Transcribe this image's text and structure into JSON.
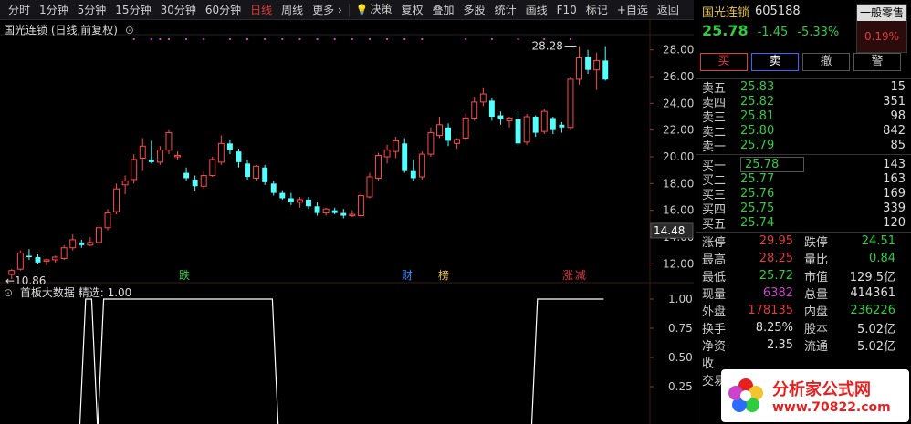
{
  "toolbar": {
    "items": [
      "分时",
      "1分钟",
      "5分钟",
      "15分钟",
      "30分钟",
      "60分钟",
      "日线",
      "周线",
      "更多 ›"
    ],
    "active_index": 6,
    "tools": [
      "决策",
      "复权",
      "叠加",
      "多股",
      "统计",
      "画线",
      "F10",
      "标记",
      "+自选",
      "返回"
    ]
  },
  "chart": {
    "title": "国光连锁 (日线,前复权)",
    "high_marker": "28.28",
    "low_marker": "10.86",
    "cursor_price": "14.48",
    "markers": [
      {
        "text": "跌",
        "color": "#2ecc40"
      },
      {
        "text": "财",
        "color": "#3b8bff"
      },
      {
        "text": "榜",
        "color": "#e8c341"
      },
      {
        "text": "涨",
        "color": "#e23b3b"
      },
      {
        "text": "减",
        "color": "#e23b3b"
      }
    ]
  },
  "indicator": {
    "title": "首板大数据 精选: 1.00",
    "ticks": [
      "1.00",
      "0.75",
      "0.50",
      "0.25"
    ]
  },
  "chart_data": {
    "type": "candlestick",
    "ylim": [
      11.0,
      29.0
    ],
    "yticks": [
      12.0,
      14.0,
      16.0,
      18.0,
      20.0,
      22.0,
      24.0,
      26.0,
      28.0
    ],
    "candles": [
      [
        11.2,
        11.6,
        10.86,
        11.5
      ],
      [
        11.6,
        13.0,
        11.5,
        12.8
      ],
      [
        12.6,
        13.1,
        12.3,
        12.5
      ],
      [
        12.5,
        12.7,
        12.0,
        12.1
      ],
      [
        12.2,
        12.4,
        11.9,
        12.3
      ],
      [
        12.3,
        12.6,
        12.1,
        12.5
      ],
      [
        12.4,
        13.4,
        12.3,
        13.2
      ],
      [
        13.2,
        14.2,
        13.0,
        13.8
      ],
      [
        13.6,
        13.8,
        13.2,
        13.4
      ],
      [
        13.4,
        14.0,
        13.3,
        13.6
      ],
      [
        13.6,
        14.9,
        13.5,
        14.7
      ],
      [
        14.7,
        16.1,
        14.5,
        15.8
      ],
      [
        15.9,
        18.0,
        15.7,
        17.6
      ],
      [
        17.9,
        18.6,
        17.2,
        18.2
      ],
      [
        18.3,
        20.2,
        18.0,
        19.8
      ],
      [
        19.9,
        21.4,
        19.0,
        20.8
      ],
      [
        19.8,
        21.2,
        19.5,
        19.6
      ],
      [
        19.6,
        20.8,
        19.4,
        20.5
      ],
      [
        20.5,
        22.0,
        20.2,
        21.8
      ],
      [
        20.0,
        20.4,
        19.8,
        20.1
      ],
      [
        18.8,
        19.2,
        18.2,
        18.4
      ],
      [
        18.3,
        18.6,
        17.4,
        17.8
      ],
      [
        17.8,
        18.9,
        17.6,
        18.6
      ],
      [
        18.6,
        20.0,
        18.5,
        19.8
      ],
      [
        19.6,
        21.6,
        19.4,
        21.0
      ],
      [
        21.0,
        21.3,
        20.2,
        20.5
      ],
      [
        20.4,
        20.6,
        19.2,
        19.6
      ],
      [
        19.5,
        19.8,
        18.3,
        18.5
      ],
      [
        18.4,
        19.4,
        18.2,
        19.3
      ],
      [
        19.2,
        19.4,
        17.9,
        18.1
      ],
      [
        18.0,
        18.2,
        17.1,
        17.3
      ],
      [
        17.3,
        17.5,
        16.8,
        16.9
      ],
      [
        16.9,
        17.3,
        16.4,
        16.6
      ],
      [
        16.6,
        17.0,
        16.2,
        16.8
      ],
      [
        16.8,
        17.0,
        16.1,
        16.3
      ],
      [
        16.3,
        16.6,
        15.6,
        15.8
      ],
      [
        15.8,
        16.2,
        15.6,
        16.1
      ],
      [
        16.0,
        16.2,
        15.7,
        15.8
      ],
      [
        15.8,
        16.1,
        15.4,
        15.6
      ],
      [
        15.6,
        16.0,
        15.5,
        15.7
      ],
      [
        15.6,
        17.3,
        15.5,
        17.1
      ],
      [
        17.0,
        18.8,
        16.9,
        18.5
      ],
      [
        18.4,
        20.3,
        18.2,
        20.1
      ],
      [
        20.0,
        20.9,
        19.5,
        20.5
      ],
      [
        20.4,
        21.5,
        19.9,
        21.2
      ],
      [
        21.0,
        21.4,
        18.8,
        19.0
      ],
      [
        19.0,
        19.8,
        18.2,
        18.4
      ],
      [
        18.5,
        20.4,
        18.3,
        20.2
      ],
      [
        20.2,
        22.2,
        20.0,
        21.8
      ],
      [
        21.6,
        23.0,
        21.4,
        22.4
      ],
      [
        22.2,
        22.5,
        20.8,
        21.2
      ],
      [
        21.0,
        21.4,
        20.6,
        21.3
      ],
      [
        21.4,
        23.2,
        21.2,
        22.9
      ],
      [
        22.9,
        24.5,
        22.7,
        24.1
      ],
      [
        24.1,
        25.2,
        23.8,
        24.7
      ],
      [
        24.2,
        24.4,
        22.7,
        23.0
      ],
      [
        23.1,
        23.4,
        22.4,
        22.8
      ],
      [
        22.7,
        23.0,
        22.2,
        22.9
      ],
      [
        22.8,
        23.4,
        20.8,
        21.0
      ],
      [
        21.1,
        23.2,
        20.9,
        23.0
      ],
      [
        23.0,
        23.1,
        21.5,
        21.8
      ],
      [
        21.9,
        23.6,
        21.7,
        23.4
      ],
      [
        22.9,
        23.0,
        21.7,
        22.0
      ],
      [
        22.4,
        22.6,
        21.8,
        22.2
      ],
      [
        22.2,
        26.0,
        22.0,
        25.8
      ],
      [
        25.8,
        28.28,
        25.4,
        27.4
      ],
      [
        27.5,
        28.0,
        26.2,
        26.5
      ],
      [
        26.5,
        27.8,
        25.0,
        27.2
      ],
      [
        27.2,
        28.28,
        25.7,
        25.78
      ]
    ],
    "indicator_values": [
      0,
      0,
      0,
      0,
      0,
      0,
      0,
      0,
      0,
      0,
      0,
      0,
      0,
      1,
      1,
      0,
      1,
      1,
      1,
      1,
      1,
      1,
      1,
      1,
      1,
      1,
      1,
      1,
      1,
      1,
      1,
      1,
      1,
      1,
      1,
      1,
      1,
      1,
      1,
      1,
      1,
      1,
      1,
      1,
      1,
      0,
      0,
      0,
      0,
      0,
      0,
      0,
      0,
      0,
      0,
      0,
      0,
      0,
      0,
      0,
      0,
      0,
      0,
      0,
      0,
      0,
      0,
      0,
      0,
      0,
      0,
      0,
      0,
      0,
      0,
      0,
      0,
      0,
      0,
      0,
      0,
      0,
      0,
      0,
      0,
      0,
      0,
      0,
      1,
      1,
      1,
      1,
      1,
      1,
      1,
      1,
      1,
      1,
      1,
      1
    ]
  },
  "quote": {
    "name": "国光连锁",
    "code": "605188",
    "lot_label": "一般零售",
    "lot_pct": "0.19%",
    "price": "25.78",
    "change": "-1.45",
    "change_pct": "-5.33%",
    "buttons": [
      "买",
      "卖",
      "撤",
      "警"
    ],
    "asks": [
      {
        "label": "卖五",
        "price": "25.83",
        "vol": "15"
      },
      {
        "label": "卖四",
        "price": "25.82",
        "vol": "351"
      },
      {
        "label": "卖三",
        "price": "25.81",
        "vol": "98"
      },
      {
        "label": "卖二",
        "price": "25.80",
        "vol": "842"
      },
      {
        "label": "卖一",
        "price": "25.79",
        "vol": "85"
      }
    ],
    "bids": [
      {
        "label": "买一",
        "price": "25.78",
        "vol": "143"
      },
      {
        "label": "买二",
        "price": "25.77",
        "vol": "163"
      },
      {
        "label": "买三",
        "price": "25.76",
        "vol": "169"
      },
      {
        "label": "买四",
        "price": "25.75",
        "vol": "339"
      },
      {
        "label": "买五",
        "price": "25.74",
        "vol": "120"
      }
    ],
    "stats": [
      {
        "k1": "涨停",
        "v1": "29.95",
        "c1": "red",
        "k2": "跌停",
        "v2": "24.51",
        "c2": "green"
      },
      {
        "k1": "最高",
        "v1": "28.25",
        "c1": "red",
        "k2": "量比",
        "v2": "0.84",
        "c2": "green"
      },
      {
        "k1": "最低",
        "v1": "25.72",
        "c1": "green",
        "k2": "市值",
        "v2": "129.5亿",
        "c2": ""
      },
      {
        "k1": "现量",
        "v1": "6382",
        "c1": "mag",
        "k2": "总量",
        "v2": "414361",
        "c2": ""
      },
      {
        "k1": "外盘",
        "v1": "178135",
        "c1": "red",
        "k2": "内盘",
        "v2": "236226",
        "c2": "green"
      },
      {
        "k1": "换手",
        "v1": "8.25%",
        "c1": "",
        "k2": "股本",
        "v2": "5.02亿",
        "c2": ""
      },
      {
        "k1": "净资",
        "v1": "2.35",
        "c1": "",
        "k2": "流通",
        "v2": "5.02亿",
        "c2": ""
      },
      {
        "k1": "收",
        "v1": "",
        "c1": "",
        "k2": "",
        "v2": "",
        "c2": ""
      }
    ],
    "stat_partial": "交易"
  },
  "logo": {
    "cn": "分析家公式网",
    "url": "www.70822.com"
  }
}
